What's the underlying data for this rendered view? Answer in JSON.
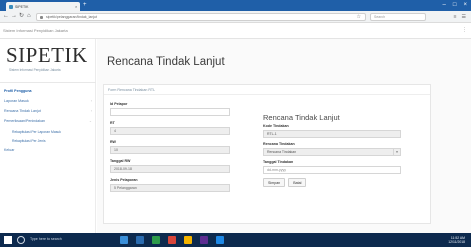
{
  "browser": {
    "tab_title": "SIPETIK",
    "url": "sipetik/pelanggaran/tindak_lanjut",
    "search_placeholder": "Search"
  },
  "app": {
    "system_name": "Sistem Informasi Penyidikan Jakarta",
    "logo_text": "SIPETIK",
    "logo_subtitle": "Sistem Informasi Penyidikan Jakarta"
  },
  "sidebar": {
    "items": [
      {
        "label": "Profil Pengguna",
        "active": true
      },
      {
        "label": "Laporan Masuk",
        "active": false
      },
      {
        "label": "Rencana Tindak Lanjut",
        "active": false
      },
      {
        "label": "Pemeriksaan/Penindakan",
        "active": false
      }
    ],
    "subitems": [
      {
        "label": "Rekapitulasi Per Laporan Masuk"
      },
      {
        "label": "Rekapitulasi Per Jenis"
      },
      {
        "label": "Keluar"
      }
    ]
  },
  "main": {
    "page_title": "Rencana Tindak Lanjut",
    "panel_header": "Form Rencana Tindakan RTL",
    "left_fields": [
      {
        "label": "Id Pelapor",
        "value": "",
        "readonly": false
      },
      {
        "label": "RT",
        "value": "4",
        "readonly": true
      },
      {
        "label": "RW",
        "value": "10",
        "readonly": true
      },
      {
        "label": "Tanggal RW",
        "value": "2018-09-18",
        "readonly": true
      },
      {
        "label": "Jenis Pelaporan",
        "value": "5 Pelanggaran",
        "readonly": true
      }
    ],
    "right_title": "Rencana Tindak Lanjut",
    "right_fields": [
      {
        "label": "Kode Tindakan",
        "value": "RTL-1",
        "readonly": true,
        "select": false
      },
      {
        "label": "Rencana Tindakan",
        "value": "Rencana Tindakan",
        "readonly": true,
        "select": true
      },
      {
        "label": "Tanggal Tindakan",
        "value": "dd-mm-yyyy",
        "readonly": false,
        "select": false
      }
    ],
    "buttons": {
      "submit": "Simpan",
      "back": "Batal"
    }
  },
  "taskbar": {
    "search_text": "Type here to search",
    "time": "11:52 AM",
    "date": "12/11/2018",
    "app_colors": [
      "#3a8fd9",
      "#2b6cb0",
      "#2d9b4a",
      "#d8453a",
      "#f4b400",
      "#5c2d91",
      "#1e88e5"
    ]
  }
}
